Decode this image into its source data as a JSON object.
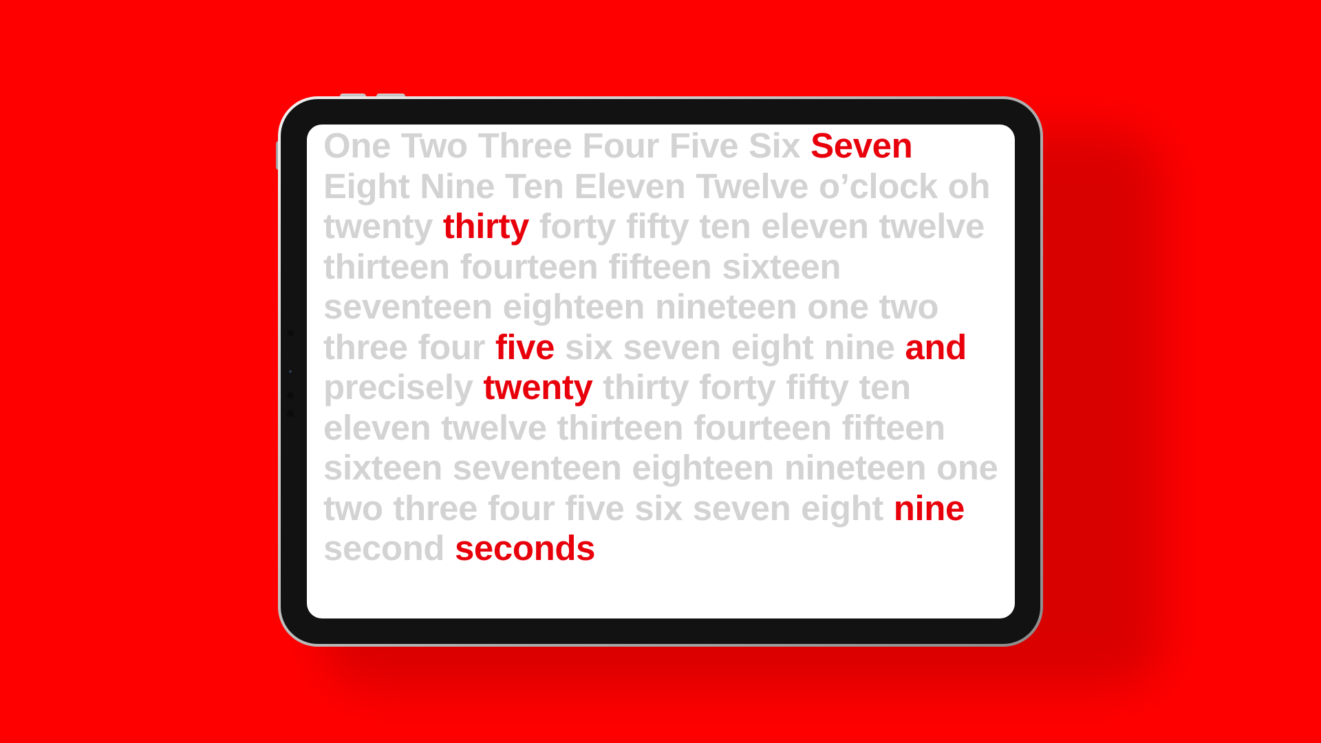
{
  "display": {
    "colors": {
      "background": "#ff0000",
      "dim_word": "#d3d3d3",
      "highlight_word": "#e8000b"
    },
    "words": [
      {
        "text": "One",
        "hi": false
      },
      {
        "text": "Two",
        "hi": false
      },
      {
        "text": "Three",
        "hi": false
      },
      {
        "text": "Four",
        "hi": false
      },
      {
        "text": "Five",
        "hi": false
      },
      {
        "text": "Six",
        "hi": false
      },
      {
        "text": "Seven",
        "hi": true
      },
      {
        "text": "Eight",
        "hi": false
      },
      {
        "text": "Nine",
        "hi": false
      },
      {
        "text": "Ten",
        "hi": false
      },
      {
        "text": "Eleven",
        "hi": false
      },
      {
        "text": "Twelve",
        "hi": false
      },
      {
        "text": "o’clock",
        "hi": false
      },
      {
        "text": "oh",
        "hi": false
      },
      {
        "text": "twenty",
        "hi": false
      },
      {
        "text": "thirty",
        "hi": true
      },
      {
        "text": "forty",
        "hi": false
      },
      {
        "text": "fifty",
        "hi": false
      },
      {
        "text": "ten",
        "hi": false
      },
      {
        "text": "eleven",
        "hi": false
      },
      {
        "text": "twelve",
        "hi": false
      },
      {
        "text": "thirteen",
        "hi": false
      },
      {
        "text": "fourteen",
        "hi": false
      },
      {
        "text": "fifteen",
        "hi": false
      },
      {
        "text": "sixteen",
        "hi": false
      },
      {
        "text": "seventeen",
        "hi": false
      },
      {
        "text": "eighteen",
        "hi": false
      },
      {
        "text": "nineteen",
        "hi": false
      },
      {
        "text": "one",
        "hi": false
      },
      {
        "text": "two",
        "hi": false
      },
      {
        "text": "three",
        "hi": false
      },
      {
        "text": "four",
        "hi": false
      },
      {
        "text": "five",
        "hi": true
      },
      {
        "text": "six",
        "hi": false
      },
      {
        "text": "seven",
        "hi": false
      },
      {
        "text": "eight",
        "hi": false
      },
      {
        "text": "nine",
        "hi": false
      },
      {
        "text": "and",
        "hi": true
      },
      {
        "text": "precisely",
        "hi": false
      },
      {
        "text": "twenty",
        "hi": true
      },
      {
        "text": "thirty",
        "hi": false
      },
      {
        "text": "forty",
        "hi": false
      },
      {
        "text": "fifty",
        "hi": false
      },
      {
        "text": "ten",
        "hi": false
      },
      {
        "text": "eleven",
        "hi": false
      },
      {
        "text": "twelve",
        "hi": false
      },
      {
        "text": "thirteen",
        "hi": false
      },
      {
        "text": "fourteen",
        "hi": false
      },
      {
        "text": "fifteen",
        "hi": false
      },
      {
        "text": "sixteen",
        "hi": false
      },
      {
        "text": "seventeen",
        "hi": false
      },
      {
        "text": "eighteen",
        "hi": false
      },
      {
        "text": "nineteen",
        "hi": false
      },
      {
        "text": "one",
        "hi": false
      },
      {
        "text": "two",
        "hi": false
      },
      {
        "text": "three",
        "hi": false
      },
      {
        "text": "four",
        "hi": false
      },
      {
        "text": "five",
        "hi": false
      },
      {
        "text": "six",
        "hi": false
      },
      {
        "text": "seven",
        "hi": false
      },
      {
        "text": "eight",
        "hi": false
      },
      {
        "text": "nine",
        "hi": true
      },
      {
        "text": "second",
        "hi": false
      },
      {
        "text": "seconds",
        "hi": true
      }
    ]
  }
}
